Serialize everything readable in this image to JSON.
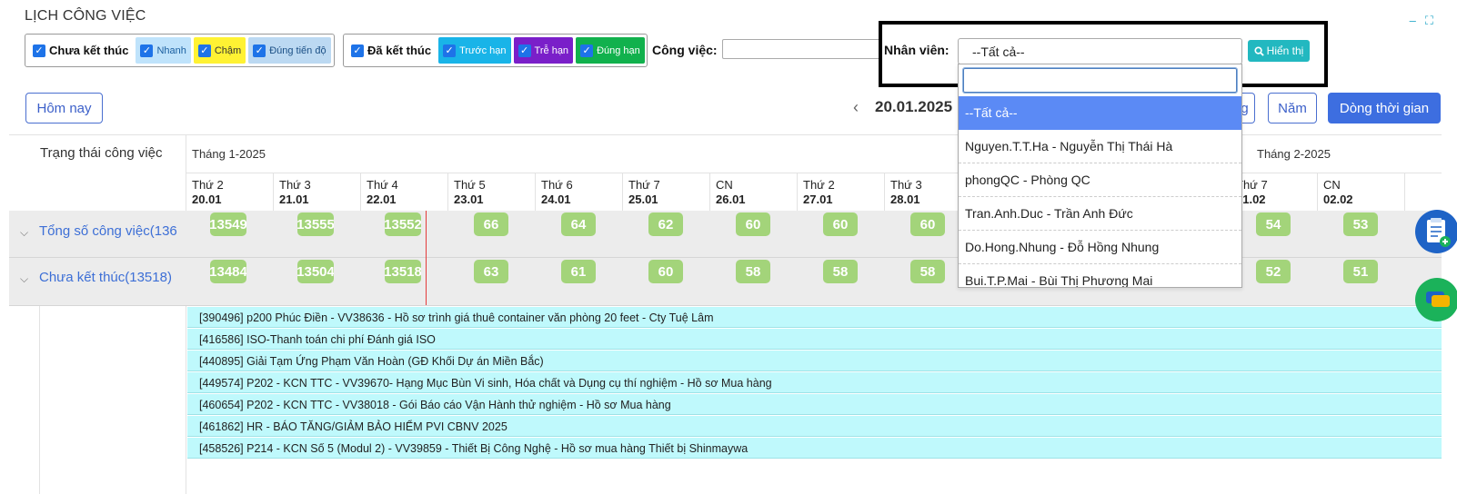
{
  "page": {
    "title": "LỊCH CÔNG VIỆC",
    "minimize_icon": "–",
    "fullscreen_icon": "⛶"
  },
  "filters": {
    "unfinished": {
      "label": "Chưa kết thúc",
      "items": [
        "Nhanh",
        "Chậm",
        "Đúng tiến độ"
      ]
    },
    "finished": {
      "label": "Đã kết thúc",
      "items": [
        "Trước hạn",
        "Trễ hạn",
        "Đúng hạn"
      ]
    },
    "job_label": "Công việc:",
    "job_value": "",
    "employee_label": "Nhân viên:",
    "employee_selected": "--Tất cả--",
    "show_button": "Hiển thị"
  },
  "toolbar": {
    "today": "Hôm nay",
    "current_date": "20.01.2025",
    "prev_icon": "‹",
    "view_partial": "g",
    "year": "Năm",
    "timeline": "Dòng thời gian"
  },
  "calendar": {
    "status_header": "Trạng thái công việc",
    "month1": "Tháng 1-2025",
    "month2": "Tháng 2-2025",
    "days": [
      {
        "dow": "Thứ 2",
        "date": "20.01"
      },
      {
        "dow": "Thứ 3",
        "date": "21.01"
      },
      {
        "dow": "Thứ 4",
        "date": "22.01"
      },
      {
        "dow": "Thứ 5",
        "date": "23.01"
      },
      {
        "dow": "Thứ 6",
        "date": "24.01"
      },
      {
        "dow": "Thứ 7",
        "date": "25.01"
      },
      {
        "dow": "CN",
        "date": "26.01"
      },
      {
        "dow": "Thứ 2",
        "date": "27.01"
      },
      {
        "dow": "Thứ 3",
        "date": "28.01"
      },
      {
        "dow": "Thứ 7",
        "date": "01.02"
      },
      {
        "dow": "CN",
        "date": "02.02"
      }
    ],
    "rows": [
      {
        "label": "Tổng số công việc(136",
        "counts": [
          "13549",
          "13555",
          "13552",
          "66",
          "64",
          "62",
          "60",
          "60",
          "60",
          "54",
          "53"
        ]
      },
      {
        "label": "Chưa kết thúc(13518)",
        "counts": [
          "13484",
          "13504",
          "13518",
          "63",
          "61",
          "60",
          "58",
          "58",
          "58",
          "52",
          "51"
        ]
      }
    ],
    "tasks": [
      "[390496] p200 Phúc Điền - VV38636 - Hồ sơ trình giá thuê container văn phòng 20 feet - Cty Tuệ Lâm",
      "[416586] ISO-Thanh toán chi phí Đánh giá ISO",
      "[440895] Giải Tạm Ứng Phạm Văn Hoàn (GĐ Khối Dự án Miền Bắc)",
      "[449574] P202 - KCN TTC - VV39670- Hạng Mục Bùn Vi sinh, Hóa chất và Dụng cụ thí nghiệm - Hồ sơ Mua hàng",
      "[460654] P202 - KCN TTC - VV38018 - Gói Báo cáo Vận Hành thử nghiệm - Hồ sơ Mua hàng",
      "[461862] HR - BÁO TĂNG/GIẢM BẢO HIỂM PVI CBNV 2025",
      "[458526] P214 - KCN Số 5 (Modul 2) - VV39859 - Thiết Bị Công Nghệ - Hồ sơ mua hàng Thiết bị Shinmaywa"
    ]
  },
  "dropdown": {
    "options": [
      "--Tất cả--",
      "Nguyen.T.T.Ha - Nguyễn Thị Thái Hà",
      "phongQC - Phòng QC",
      "Tran.Anh.Duc - Trần Anh Đức",
      "Do.Hong.Nhung - Đỗ Hồng Nhung",
      "Bui.T.P.Mai - Bùi Thị Phương Mai"
    ]
  },
  "colors": {
    "accent": "#3d6ee0",
    "count_badge": "#a3d47a",
    "task_bg": "#bff9fc"
  }
}
